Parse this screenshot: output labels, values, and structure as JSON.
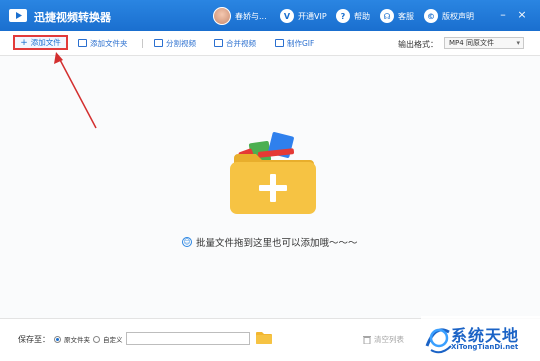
{
  "app": {
    "title": "迅捷视频转换器",
    "user_name": "春娇与...",
    "vip_label": "开通VIP",
    "help_label": "帮助",
    "service_label": "客服",
    "copyright_label": "版权声明"
  },
  "toolbar": {
    "add_file": "添加文件",
    "add_folder": "添加文件夹",
    "split_video": "分割视频",
    "merge_video": "合并视频",
    "make_gif": "制作GIF",
    "format_label": "输出格式：",
    "format_value": "MP4 同原文件"
  },
  "drop_area": {
    "hint": "批量文件拖到这里也可以添加哦～～～"
  },
  "bottom": {
    "save_to": "保存至：",
    "option_original": "原文件夹",
    "option_custom": "自定义",
    "path_value": "",
    "clear_list": "清空列表"
  },
  "watermark": {
    "title": "系统天地",
    "url": "XiTongTianDi.net"
  },
  "colors": {
    "titlebar": "#1a6fcf",
    "accent": "#2a6fcf",
    "highlight_border": "#e23b3b",
    "folder": "#f6c343"
  }
}
